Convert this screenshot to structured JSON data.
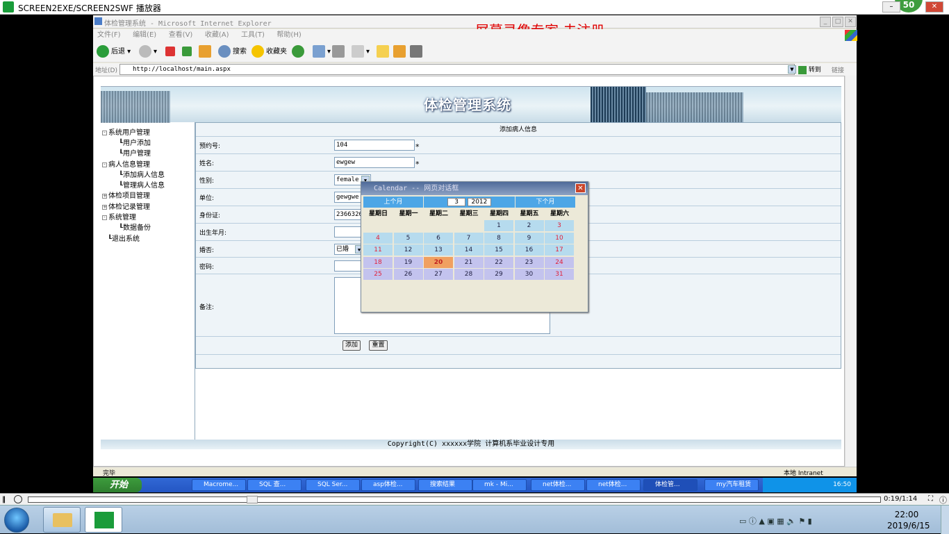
{
  "player": {
    "title": "SCREEN2EXE/SCREEN2SWF 播放器",
    "badge": "50",
    "time": "0:19/1:14"
  },
  "ie": {
    "title": "体检管理系统 - Microsoft Internet Explorer",
    "watermark": "屏幕录像专家 未注册",
    "menu": [
      "文件(F)",
      "编辑(E)",
      "查看(V)",
      "收藏(A)",
      "工具(T)",
      "帮助(H)"
    ],
    "toolbar": {
      "back": "后退",
      "search": "搜索",
      "favorites": "收藏夹"
    },
    "address_label": "地址(D)",
    "address": "http://localhost/main.aspx",
    "go": "转到",
    "links": "链接",
    "status_left": "完毕",
    "status_right": "本地 Intranet"
  },
  "site": {
    "title": "体检管理系统",
    "copyright": "Copyright(C) xxxxxx学院 计算机系毕业设计专用"
  },
  "nav": [
    {
      "label": "系统用户管理",
      "level": 0,
      "toggle": "-"
    },
    {
      "label": "用户添加",
      "level": 1
    },
    {
      "label": "用户管理",
      "level": 1
    },
    {
      "label": "病人信息管理",
      "level": 0,
      "toggle": "-"
    },
    {
      "label": "添加病人信息",
      "level": 1
    },
    {
      "label": "管理病人信息",
      "level": 1
    },
    {
      "label": "体检项目管理",
      "level": 0,
      "toggle": "+"
    },
    {
      "label": "体检记录管理",
      "level": 0,
      "toggle": "+"
    },
    {
      "label": "系统管理",
      "level": 0,
      "toggle": "-"
    },
    {
      "label": "数据备份",
      "level": 1
    },
    {
      "label": "退出系统",
      "level": 0
    }
  ],
  "form": {
    "heading": "添加病人信息",
    "fields": {
      "appt_no": {
        "label": "预约号:",
        "value": "104",
        "required": "*"
      },
      "name": {
        "label": "姓名:",
        "value": "ewgew",
        "required": "*"
      },
      "gender": {
        "label": "性别:",
        "value": "female"
      },
      "unit": {
        "label": "单位:",
        "value": "gewgwe"
      },
      "id_card": {
        "label": "身份证:",
        "value": "2366326"
      },
      "birth": {
        "label": "出生年月:",
        "value": ""
      },
      "married": {
        "label": "婚否:",
        "value": "已婚"
      },
      "password": {
        "label": "密码:",
        "value": ""
      },
      "remark": {
        "label": "备注:",
        "value": ""
      }
    },
    "add_button": "添加",
    "reset_button": "重置"
  },
  "calendar": {
    "title": "Calendar -- 网页对话框",
    "prev": "上个月",
    "next": "下个月",
    "month": "3",
    "year": "2012",
    "dow": [
      "星期日",
      "星期一",
      "星期二",
      "星期三",
      "星期四",
      "星期五",
      "星期六"
    ],
    "weeks": [
      [
        "",
        "",
        "",
        "",
        "1",
        "2",
        "3"
      ],
      [
        "4",
        "5",
        "6",
        "7",
        "8",
        "9",
        "10"
      ],
      [
        "11",
        "12",
        "13",
        "14",
        "15",
        "16",
        "17"
      ],
      [
        "18",
        "19",
        "20",
        "21",
        "22",
        "23",
        "24"
      ],
      [
        "25",
        "26",
        "27",
        "28",
        "29",
        "30",
        "31"
      ]
    ],
    "today": "20",
    "colors": {
      "header": "#4da6e6",
      "weekend": "#e0203a",
      "cell": "#b6dbee",
      "last_rows": "#c3c3ee",
      "today": "#f0a060"
    }
  },
  "xp_taskbar": {
    "start": "开始",
    "tasks": [
      "Macrome...",
      "SQL 查...",
      "SQL Ser...",
      "asp体检...",
      "搜索结果",
      "mk - Mi...",
      "net体检...",
      "net体检...",
      "体检管...",
      "my汽车租赁"
    ],
    "clock": "16:50"
  },
  "win7": {
    "time": "22:00",
    "date": "2019/6/15"
  }
}
